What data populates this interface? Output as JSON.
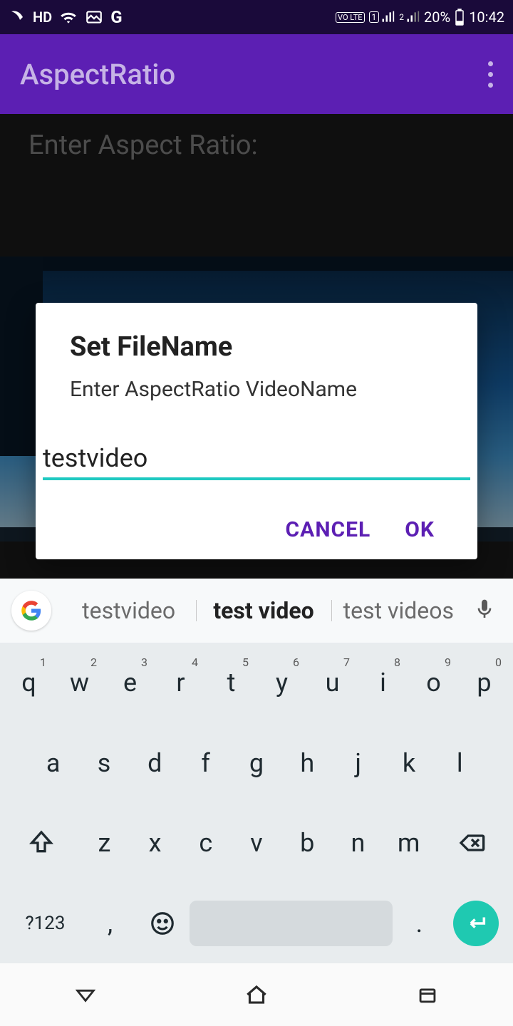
{
  "status": {
    "hd": "HD",
    "volte": "VO LTE",
    "sim1": "1",
    "sim2": "2",
    "battery": "20%",
    "time": "10:42"
  },
  "appbar": {
    "title": "AspectRatio"
  },
  "page": {
    "label": "Enter Aspect Ratio:"
  },
  "dialog": {
    "title": "Set FileName",
    "subtitle": "Enter AspectRatio VideoName",
    "input_value": "testvideo",
    "cancel": "CANCEL",
    "ok": "OK"
  },
  "keyboard": {
    "suggestions": [
      "testvideo",
      "test video",
      "test videos"
    ],
    "row1": [
      {
        "k": "q",
        "n": "1"
      },
      {
        "k": "w",
        "n": "2"
      },
      {
        "k": "e",
        "n": "3"
      },
      {
        "k": "r",
        "n": "4"
      },
      {
        "k": "t",
        "n": "5"
      },
      {
        "k": "y",
        "n": "6"
      },
      {
        "k": "u",
        "n": "7"
      },
      {
        "k": "i",
        "n": "8"
      },
      {
        "k": "o",
        "n": "9"
      },
      {
        "k": "p",
        "n": "0"
      }
    ],
    "row2": [
      "a",
      "s",
      "d",
      "f",
      "g",
      "h",
      "j",
      "k",
      "l"
    ],
    "row3": [
      "z",
      "x",
      "c",
      "v",
      "b",
      "n",
      "m"
    ],
    "sym": "?123",
    "comma": ",",
    "period": "."
  }
}
